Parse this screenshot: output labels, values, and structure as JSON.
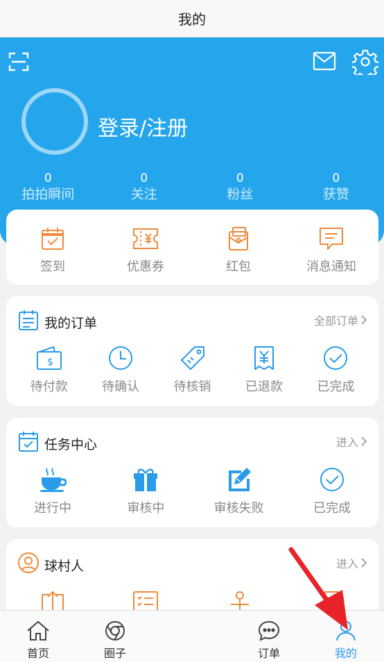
{
  "header": {
    "title": "我的"
  },
  "profile": {
    "login_label": "登录/注册"
  },
  "stats": [
    {
      "value": "0",
      "label": "拍拍瞬间"
    },
    {
      "value": "0",
      "label": "关注"
    },
    {
      "value": "0",
      "label": "粉丝"
    },
    {
      "value": "0",
      "label": "获赞"
    }
  ],
  "quick_actions": [
    {
      "label": "签到",
      "icon": "calendar-check-icon"
    },
    {
      "label": "优惠券",
      "icon": "coupon-icon"
    },
    {
      "label": "红包",
      "icon": "red-packet-icon"
    },
    {
      "label": "消息通知",
      "icon": "message-icon"
    }
  ],
  "orders": {
    "title": "我的订单",
    "more": "全部订单",
    "items": [
      {
        "label": "待付款",
        "icon": "wallet-icon"
      },
      {
        "label": "待确认",
        "icon": "clock-icon"
      },
      {
        "label": "待核销",
        "icon": "tag-icon"
      },
      {
        "label": "已退款",
        "icon": "refund-icon"
      },
      {
        "label": "已完成",
        "icon": "check-circle-icon"
      }
    ]
  },
  "tasks": {
    "title": "任务中心",
    "more": "进入",
    "items": [
      {
        "label": "进行中",
        "icon": "coffee-icon"
      },
      {
        "label": "审核中",
        "icon": "gift-icon"
      },
      {
        "label": "审核失败",
        "icon": "edit-icon"
      },
      {
        "label": "已完成",
        "icon": "check-circle-icon"
      }
    ]
  },
  "village": {
    "title": "球村人",
    "more": "进入"
  },
  "tabbar": [
    {
      "label": "首页",
      "icon": "home-icon",
      "active": false
    },
    {
      "label": "圈子",
      "icon": "circle-icon",
      "active": false
    },
    {
      "label": "订单",
      "icon": "chat-icon",
      "active": false
    },
    {
      "label": "我的",
      "icon": "user-icon",
      "active": true
    }
  ],
  "colors": {
    "brand_blue": "#25a6ec",
    "accent_orange": "#f08a3c",
    "tab_active": "#2a9be8"
  }
}
